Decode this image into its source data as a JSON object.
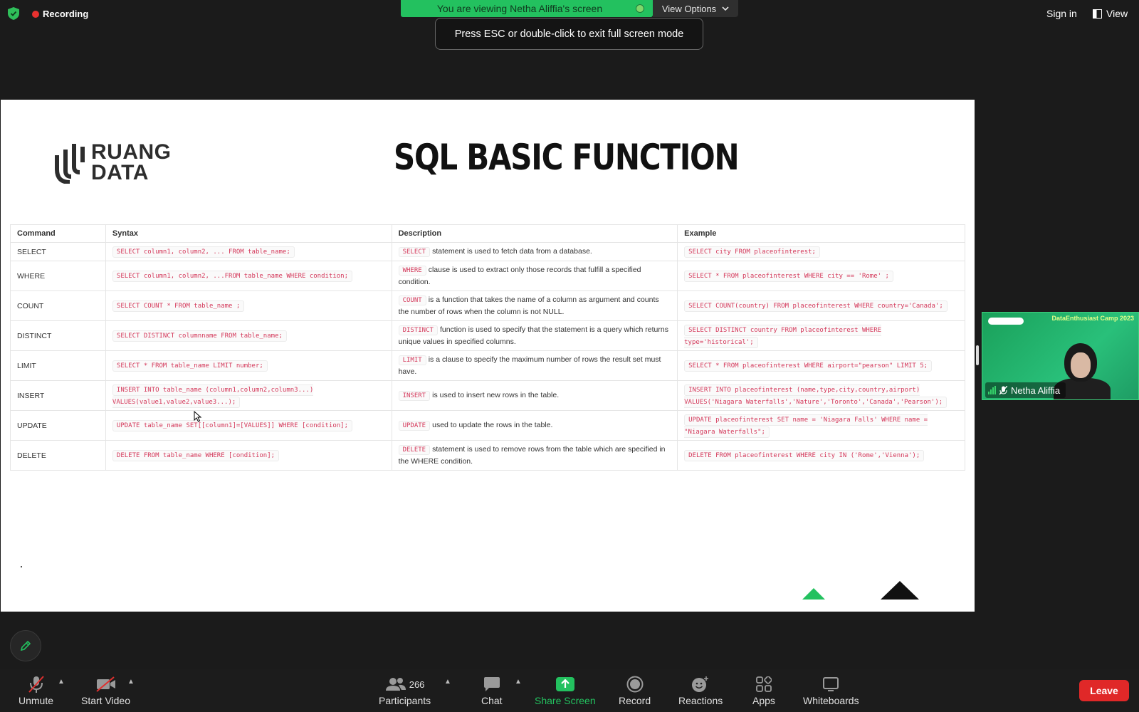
{
  "topbar": {
    "recording_label": "Recording",
    "viewing_text": "You are viewing Netha Aliffia's screen",
    "view_options_label": "View Options",
    "esc_tip": "Press ESC or double-click to exit full screen mode",
    "sign_in_label": "Sign in",
    "view_label": "View"
  },
  "slide": {
    "logo_line1": "RUANG",
    "logo_line2": "DATA",
    "title": "SQL BASIC FUNCTION",
    "columns": [
      "Command",
      "Syntax",
      "Description",
      "Example"
    ],
    "rows": [
      {
        "command": "SELECT",
        "syntax": "SELECT column1, column2, ... FROM table_name;",
        "desc_code": "SELECT",
        "desc_text": "statement is used to fetch data from a database.",
        "example": "SELECT city FROM placeofinterest;"
      },
      {
        "command": "WHERE",
        "syntax": "SELECT column1, column2, ...FROM table_name WHERE condition;",
        "desc_code": "WHERE",
        "desc_text": "clause is used to extract only those records that fulfill a specified condition.",
        "example": "SELECT * FROM placeofinterest WHERE city == 'Rome' ;"
      },
      {
        "command": "COUNT",
        "syntax": "SELECT COUNT * FROM table_name ;",
        "desc_code": "COUNT",
        "desc_text": "is a function that takes the name of a column as argument and counts the number of rows when the column is not NULL.",
        "example": "SELECT COUNT(country) FROM placeofinterest WHERE country='Canada';"
      },
      {
        "command": "DISTINCT",
        "syntax": "SELECT DISTINCT columnname FROM table_name;",
        "desc_code": "DISTINCT",
        "desc_text": "function is used to specify that the statement is a query which returns unique values in specified columns.",
        "example": "SELECT DISTINCT country FROM placeofinterest WHERE type='historical';"
      },
      {
        "command": "LIMIT",
        "syntax": "SELECT * FROM table_name LIMIT number;",
        "desc_code": "LIMIT",
        "desc_text": "is a clause to specify the maximum number of rows the result set must have.",
        "example": "SELECT * FROM placeofinterest WHERE airport=\"pearson\" LIMIT 5;"
      },
      {
        "command": "INSERT",
        "syntax": "INSERT INTO table_name (column1,column2,column3...) VALUES(value1,value2,value3...);",
        "desc_code": "INSERT",
        "desc_text": "is used to insert new rows in the table.",
        "example": "INSERT INTO placeofinterest (name,type,city,country,airport) VALUES('Niagara Waterfalls','Nature','Toronto','Canada','Pearson');"
      },
      {
        "command": "UPDATE",
        "syntax": "UPDATE table_name SET[[column1]=[VALUES]] WHERE [condition];",
        "desc_code": "UPDATE",
        "desc_text": "used to update the rows in the table.",
        "example": "UPDATE placeofinterest SET name = 'Niagara Falls' WHERE name = \"Niagara Waterfalls\";"
      },
      {
        "command": "DELETE",
        "syntax": "DELETE FROM table_name WHERE [condition];",
        "desc_code": "DELETE",
        "desc_text": "statement is used to remove rows from the table which are specified in the WHERE condition.",
        "example": "DELETE FROM placeofinterest WHERE city IN ('Rome','Vienna');"
      }
    ]
  },
  "video_tile": {
    "participant_name": "Netha Aliffia",
    "banner_text": "DataEnthusiast Camp 2023"
  },
  "toolbar": {
    "unmute_label": "Unmute",
    "start_video_label": "Start Video",
    "participants_label": "Participants",
    "participants_count": "266",
    "chat_label": "Chat",
    "share_screen_label": "Share Screen",
    "record_label": "Record",
    "reactions_label": "Reactions",
    "apps_label": "Apps",
    "whiteboards_label": "Whiteboards",
    "leave_label": "Leave"
  },
  "colors": {
    "accent_green": "#23c15f",
    "leave_red": "#e02828",
    "code_pink": "#d4385a"
  }
}
